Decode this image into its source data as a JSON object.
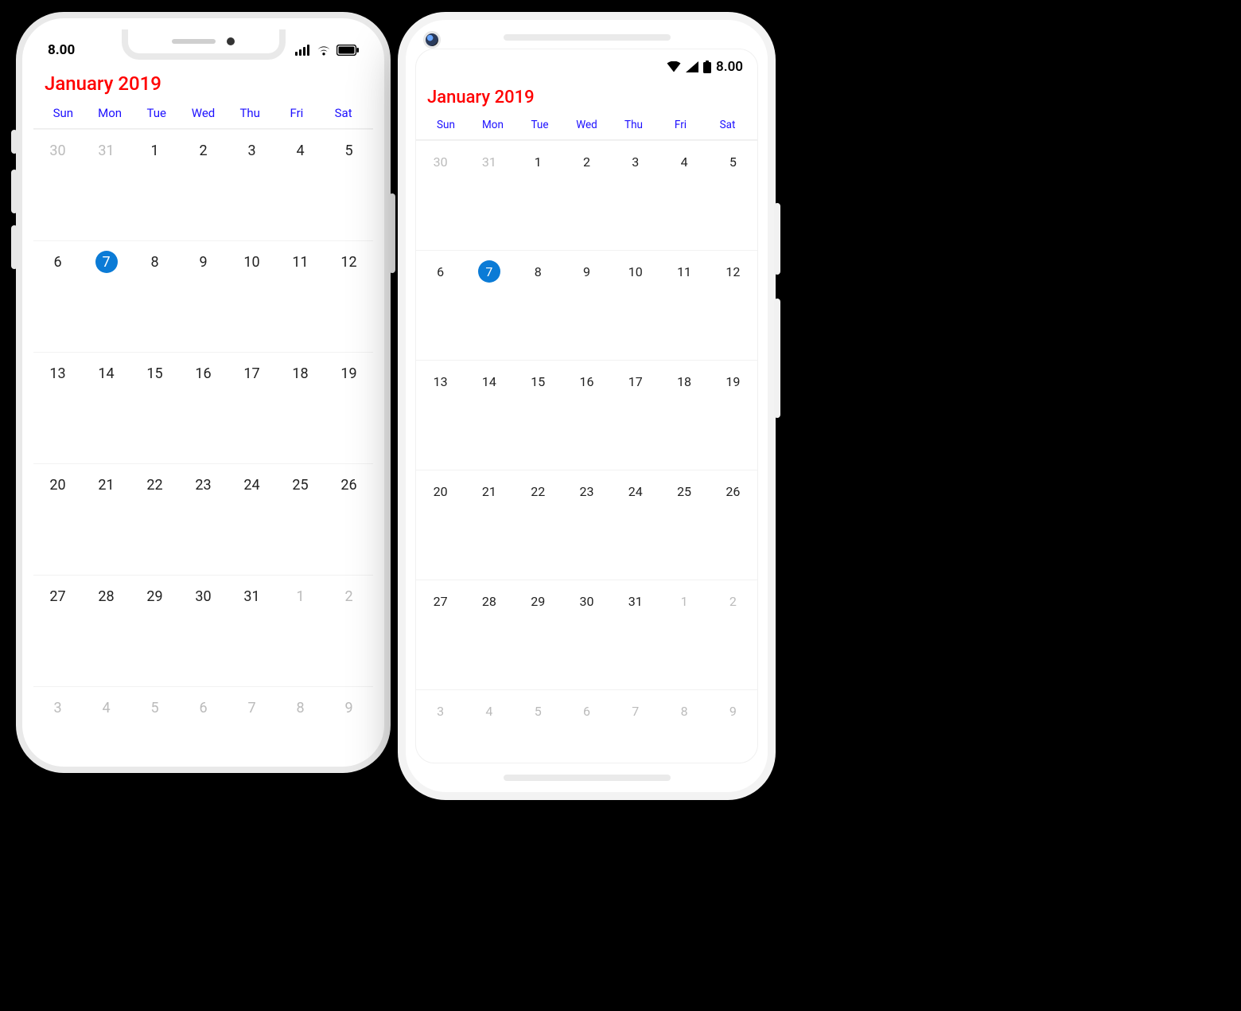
{
  "status": {
    "time": "8.00"
  },
  "calendar": {
    "title": "January 2019",
    "days": [
      "Sun",
      "Mon",
      "Tue",
      "Wed",
      "Thu",
      "Fri",
      "Sat"
    ],
    "selected": 7,
    "weeks": [
      [
        {
          "n": 30,
          "o": true
        },
        {
          "n": 31,
          "o": true
        },
        {
          "n": 1
        },
        {
          "n": 2
        },
        {
          "n": 3
        },
        {
          "n": 4
        },
        {
          "n": 5
        }
      ],
      [
        {
          "n": 6
        },
        {
          "n": 7,
          "sel": true
        },
        {
          "n": 8
        },
        {
          "n": 9
        },
        {
          "n": 10
        },
        {
          "n": 11
        },
        {
          "n": 12
        }
      ],
      [
        {
          "n": 13
        },
        {
          "n": 14
        },
        {
          "n": 15
        },
        {
          "n": 16
        },
        {
          "n": 17
        },
        {
          "n": 18
        },
        {
          "n": 19
        }
      ],
      [
        {
          "n": 20
        },
        {
          "n": 21
        },
        {
          "n": 22
        },
        {
          "n": 23
        },
        {
          "n": 24
        },
        {
          "n": 25
        },
        {
          "n": 26
        }
      ],
      [
        {
          "n": 27
        },
        {
          "n": 28
        },
        {
          "n": 29
        },
        {
          "n": 30
        },
        {
          "n": 31
        },
        {
          "n": 1,
          "o": true
        },
        {
          "n": 2,
          "o": true
        }
      ],
      [
        {
          "n": 3,
          "o": true
        },
        {
          "n": 4,
          "o": true
        },
        {
          "n": 5,
          "o": true
        },
        {
          "n": 6,
          "o": true
        },
        {
          "n": 7,
          "o": true
        },
        {
          "n": 8,
          "o": true
        },
        {
          "n": 9,
          "o": true
        }
      ]
    ]
  },
  "colors": {
    "title": "#ff0000",
    "dayHeader": "#1d10ff",
    "selected": "#0b7bd6"
  }
}
